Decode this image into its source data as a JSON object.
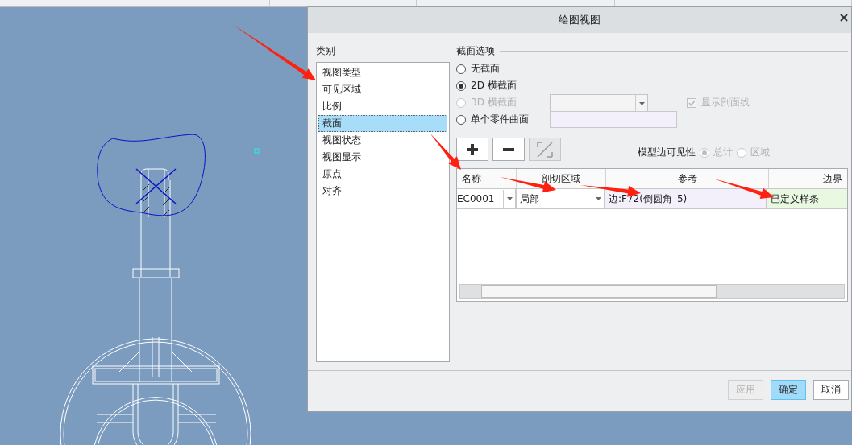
{
  "window": {
    "title": "绘图视图"
  },
  "categories": {
    "label": "类别",
    "items": [
      {
        "label": "视图类型",
        "selected": false
      },
      {
        "label": "可见区域",
        "selected": false
      },
      {
        "label": "比例",
        "selected": false
      },
      {
        "label": "截面",
        "selected": true
      },
      {
        "label": "视图状态",
        "selected": false
      },
      {
        "label": "视图显示",
        "selected": false
      },
      {
        "label": "原点",
        "selected": false
      },
      {
        "label": "对齐",
        "selected": false
      }
    ]
  },
  "section_options": {
    "label": "截面选项",
    "options": [
      {
        "label": "无截面",
        "selected": false,
        "disabled": false
      },
      {
        "label": "2D 横截面",
        "selected": true,
        "disabled": false
      },
      {
        "label": "3D 横截面",
        "selected": false,
        "disabled": true
      },
      {
        "label": "单个零件曲面",
        "selected": false,
        "disabled": false
      }
    ]
  },
  "show_hatching": {
    "label": "显示剖面线",
    "checked": true,
    "disabled": true
  },
  "toolbar": [
    {
      "kind": "add",
      "disabled": false
    },
    {
      "kind": "remove",
      "disabled": false
    },
    {
      "kind": "flip",
      "disabled": true
    }
  ],
  "model_edge_visibility": {
    "label": "模型边可见性",
    "disabled": true,
    "options": [
      {
        "label": "总计",
        "selected": true
      },
      {
        "label": "区域",
        "selected": false
      }
    ]
  },
  "table": {
    "columns": [
      "名称",
      "剖切区域",
      "参考",
      "边界"
    ],
    "rows": [
      {
        "name": "EC0001",
        "region": "局部",
        "reference": "边:F72(倒圆角_5)",
        "boundary": "已定义样条"
      }
    ]
  },
  "buttons": [
    {
      "label": "应用",
      "disabled": true,
      "default": false
    },
    {
      "label": "确定",
      "disabled": false,
      "default": true
    },
    {
      "label": "取消",
      "disabled": false,
      "default": false
    }
  ]
}
